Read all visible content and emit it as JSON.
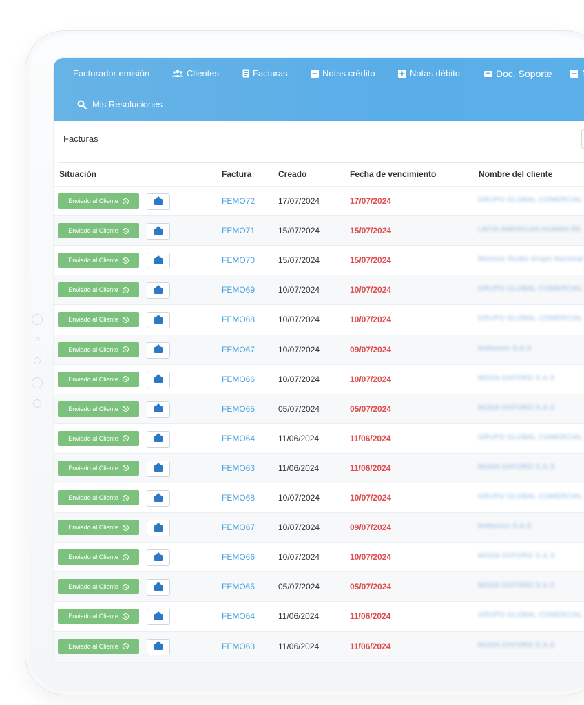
{
  "nav": {
    "items": [
      {
        "label": "Facturador emisión",
        "icon": ""
      },
      {
        "label": "Clientes",
        "icon": "users-icon"
      },
      {
        "label": "Facturas",
        "icon": "document-icon"
      },
      {
        "label": "Notas crédito",
        "icon": "minus-square-icon"
      },
      {
        "label": "Notas débito",
        "icon": "plus-square-icon"
      },
      {
        "label": "Doc. Soporte",
        "icon": "support-doc-icon"
      },
      {
        "label": "N",
        "icon": "minus-square-icon"
      }
    ],
    "search_item": {
      "label": "Mis Resoluciones",
      "icon": "search-icon"
    }
  },
  "section": {
    "title": "Facturas"
  },
  "table": {
    "headers": [
      "Situación",
      "Factura",
      "Creado",
      "Fecha de vencimiento",
      "Nombre del cliente"
    ],
    "status_label": "Enviado al Cliente",
    "rows": [
      {
        "invoice": "FEMO72",
        "created": "17/07/2024",
        "due": "17/07/2024",
        "client": "GRUPO GLOBAL COMERCIAL"
      },
      {
        "invoice": "FEMO71",
        "created": "15/07/2024",
        "due": "15/07/2024",
        "client": "LATIN AMERICAN HUMAN RE"
      },
      {
        "invoice": "FEMO70",
        "created": "15/07/2024",
        "due": "15/07/2024",
        "client": "Moresia Studio Grupo Nacional"
      },
      {
        "invoice": "FEMO69",
        "created": "10/07/2024",
        "due": "10/07/2024",
        "client": "GRUPO GLOBAL COMERCIAL"
      },
      {
        "invoice": "FEMO68",
        "created": "10/07/2024",
        "due": "10/07/2024",
        "client": "GRUPO GLOBAL COMERCIAL"
      },
      {
        "invoice": "FEMO67",
        "created": "10/07/2024",
        "due": "09/07/2024",
        "client": "Notbeson S.A.S"
      },
      {
        "invoice": "FEMO66",
        "created": "10/07/2024",
        "due": "10/07/2024",
        "client": "MODA OXFORD S.A.S"
      },
      {
        "invoice": "FEMO65",
        "created": "05/07/2024",
        "due": "05/07/2024",
        "client": "MODA OXFORD S.A.S"
      },
      {
        "invoice": "FEMO64",
        "created": "11/06/2024",
        "due": "11/06/2024",
        "client": "GRUPO GLOBAL COMERCIAL"
      },
      {
        "invoice": "FEMO63",
        "created": "11/06/2024",
        "due": "11/06/2024",
        "client": "MODA OXFORD S.A.S"
      },
      {
        "invoice": "FEMO68",
        "created": "10/07/2024",
        "due": "10/07/2024",
        "client": "GRUPO GLOBAL COMERCIAL"
      },
      {
        "invoice": "FEMO67",
        "created": "10/07/2024",
        "due": "09/07/2024",
        "client": "Notbeson S.A.S"
      },
      {
        "invoice": "FEMO66",
        "created": "10/07/2024",
        "due": "10/07/2024",
        "client": "MODA OXFORD S.A.S"
      },
      {
        "invoice": "FEMO65",
        "created": "05/07/2024",
        "due": "05/07/2024",
        "client": "MODA OXFORD S.A.S"
      },
      {
        "invoice": "FEMO64",
        "created": "11/06/2024",
        "due": "11/06/2024",
        "client": "GRUPO GLOBAL COMERCIAL"
      },
      {
        "invoice": "FEMO63",
        "created": "11/06/2024",
        "due": "11/06/2024",
        "client": "MODA OXFORD S.A.S"
      }
    ]
  },
  "colors": {
    "topbar": "#5aaee8",
    "status_green": "#7cc17e",
    "invoice_link": "#4aa3e0",
    "due_red": "#e04b4b",
    "mail_blue": "#2d79c4"
  }
}
